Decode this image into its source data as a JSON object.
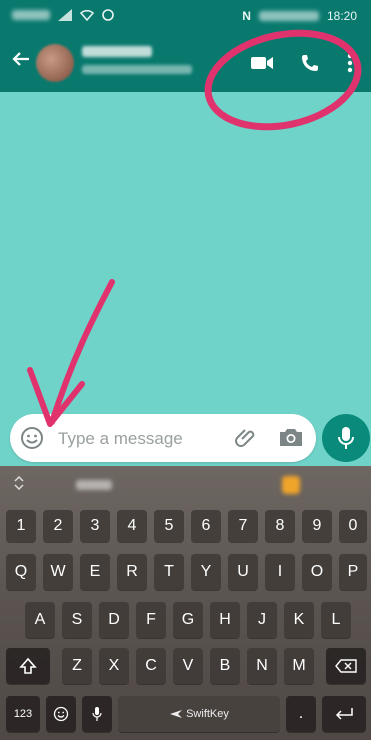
{
  "status": {
    "time": "18:20"
  },
  "composer": {
    "placeholder": "Type a message"
  },
  "keyboard": {
    "numbers": [
      "1",
      "2",
      "3",
      "4",
      "5",
      "6",
      "7",
      "8",
      "9",
      "0"
    ],
    "row1": [
      "Q",
      "W",
      "E",
      "R",
      "T",
      "Y",
      "U",
      "I",
      "O",
      "P"
    ],
    "row2": [
      "A",
      "S",
      "D",
      "F",
      "G",
      "H",
      "J",
      "K",
      "L"
    ],
    "row3": [
      "Z",
      "X",
      "C",
      "V",
      "B",
      "N",
      "M"
    ],
    "mode_key": "123",
    "space_label": "SwiftKey",
    "punct_key": "."
  },
  "colors": {
    "header": "#09796e",
    "chat_bg": "#6fd3c9",
    "accent": "#0a8a7b",
    "annotation": "#e0336e"
  }
}
